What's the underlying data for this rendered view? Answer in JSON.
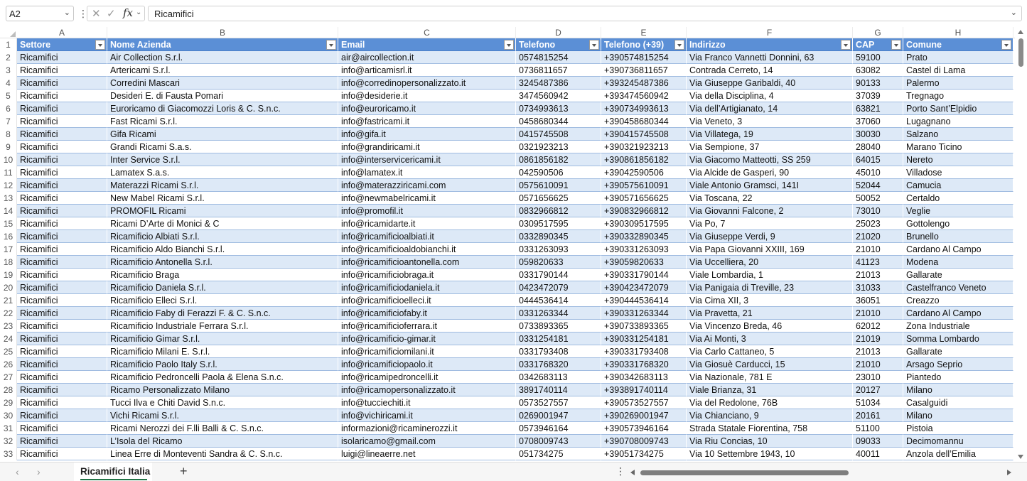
{
  "name_box": "A2",
  "formula_value": "Ricamifici",
  "columns": [
    "A",
    "B",
    "C",
    "D",
    "E",
    "F",
    "G",
    "H"
  ],
  "headers": [
    "Settore",
    "Nome Azienda",
    "Email",
    "Telefono",
    "Telefono (+39)",
    "Indirizzo",
    "CAP",
    "Comune"
  ],
  "rows": [
    [
      "Ricamifici",
      "Air Collection S.r.l.",
      "air@aircollection.it",
      "0574815254",
      "+390574815254",
      "Via Franco Vannetti Donnini, 63",
      "59100",
      "Prato"
    ],
    [
      "Ricamifici",
      "Artericami S.r.l.",
      "info@articamisrl.it",
      "0736811657",
      "+390736811657",
      "Contrada Cerreto, 14",
      "63082",
      "Castel di Lama"
    ],
    [
      "Ricamifici",
      "Corredini Mascari",
      "info@corredinopersonalizzato.it",
      "3245487386",
      "+393245487386",
      "Via Giuseppe Garibaldi, 40",
      "90133",
      "Palermo"
    ],
    [
      "Ricamifici",
      "Desideri E. di Fausta Pomari",
      "info@desiderie.it",
      "3474560942",
      "+393474560942",
      "Via della Disciplina, 4",
      "37039",
      "Tregnago"
    ],
    [
      "Ricamifici",
      "Euroricamo di Giacomozzi Loris & C. S.n.c.",
      "info@euroricamo.it",
      "0734993613",
      "+390734993613",
      "Via dell’Artigianato, 14",
      "63821",
      "Porto Sant’Elpidio"
    ],
    [
      "Ricamifici",
      "Fast Ricami S.r.l.",
      "info@fastricami.it",
      "0458680344",
      "+390458680344",
      "Via Veneto, 3",
      "37060",
      "Lugagnano"
    ],
    [
      "Ricamifici",
      "Gifa Ricami",
      "info@gifa.it",
      "0415745508",
      "+390415745508",
      "Via Villatega, 19",
      "30030",
      "Salzano"
    ],
    [
      "Ricamifici",
      "Grandi Ricami S.a.s.",
      "info@grandiricami.it",
      "0321923213",
      "+390321923213",
      "Via Sempione, 37",
      "28040",
      "Marano Ticino"
    ],
    [
      "Ricamifici",
      "Inter Service S.r.l.",
      "info@interservicericami.it",
      "0861856182",
      "+390861856182",
      "Via Giacomo Matteotti, SS 259",
      "64015",
      "Nereto"
    ],
    [
      "Ricamifici",
      "Lamatex S.a.s.",
      "info@lamatex.it",
      "042590506",
      "+39042590506",
      "Via Alcide de Gasperi, 90",
      "45010",
      "Villadose"
    ],
    [
      "Ricamifici",
      "Materazzi Ricami S.r.l.",
      "info@materazziricami.com",
      "0575610091",
      "+390575610091",
      "Viale Antonio Gramsci, 141I",
      "52044",
      "Camucia"
    ],
    [
      "Ricamifici",
      "New Mabel Ricami S.r.l.",
      "info@newmabelricami.it",
      "0571656625",
      "+390571656625",
      "Via Toscana, 22",
      "50052",
      "Certaldo"
    ],
    [
      "Ricamifici",
      "PROMOFIL Ricami",
      "info@promofil.it",
      "0832966812",
      "+390832966812",
      "Via Giovanni Falcone, 2",
      "73010",
      "Veglie"
    ],
    [
      "Ricamifici",
      "Ricami D’Arte di Monici & C",
      "info@ricamidarte.it",
      "0309517595",
      "+390309517595",
      "Via Po, 7",
      "25023",
      "Gottolengo"
    ],
    [
      "Ricamifici",
      "Ricamificio Albiati S.r.l.",
      "info@ricamificioalbiati.it",
      "0332890345",
      "+390332890345",
      "Via Giuseppe Verdi, 9",
      "21020",
      "Brunello"
    ],
    [
      "Ricamifici",
      "Ricamificio Aldo Bianchi S.r.l.",
      "info@ricamificioaldobianchi.it",
      "0331263093",
      "+390331263093",
      "Via Papa Giovanni XXIII, 169",
      "21010",
      "Cardano Al Campo"
    ],
    [
      "Ricamifici",
      "Ricamificio Antonella S.r.l.",
      "info@ricamificioantonella.com",
      "059820633",
      "+39059820633",
      "Via Uccelliera, 20",
      "41123",
      "Modena"
    ],
    [
      "Ricamifici",
      "Ricamificio Braga",
      "info@ricamificiobraga.it",
      "0331790144",
      "+390331790144",
      "Viale Lombardia, 1",
      "21013",
      "Gallarate"
    ],
    [
      "Ricamifici",
      "Ricamificio Daniela S.r.l.",
      "info@ricamificiodaniela.it",
      "0423472079",
      "+390423472079",
      "Via Panigaia di Treville, 23",
      "31033",
      "Castelfranco Veneto"
    ],
    [
      "Ricamifici",
      "Ricamificio Elleci S.r.l.",
      "info@ricamificioelleci.it",
      "0444536414",
      "+390444536414",
      "Via Cima XII, 3",
      "36051",
      "Creazzo"
    ],
    [
      "Ricamifici",
      "Ricamificio Faby di Ferazzi F. & C. S.n.c.",
      "info@ricamificiofaby.it",
      "0331263344",
      "+390331263344",
      "Via Pravetta, 21",
      "21010",
      "Cardano Al Campo"
    ],
    [
      "Ricamifici",
      "Ricamificio Industriale Ferrara S.r.l.",
      "info@ricamificioferrara.it",
      "0733893365",
      "+390733893365",
      "Via Vincenzo Breda, 46",
      "62012",
      "Zona Industriale"
    ],
    [
      "Ricamifici",
      "Ricamificio Gimar S.r.l.",
      "info@ricamificio-gimar.it",
      "0331254181",
      "+390331254181",
      "Via Ai Monti, 3",
      "21019",
      "Somma Lombardo"
    ],
    [
      "Ricamifici",
      "Ricamificio Milani E. S.r.l.",
      "info@ricamificiomilani.it",
      "0331793408",
      "+390331793408",
      "Via Carlo Cattaneo, 5",
      "21013",
      "Gallarate"
    ],
    [
      "Ricamifici",
      "Ricamificio Paolo Italy S.r.l.",
      "info@ricamificiopaolo.it",
      "0331768320",
      "+390331768320",
      "Via Giosuè Carducci, 15",
      "21010",
      "Arsago Seprio"
    ],
    [
      "Ricamifici",
      "Ricamificio Pedroncelli Paola & Elena S.n.c.",
      "info@ricamipedroncelli.it",
      "0342683113",
      "+390342683113",
      "Via Nazionale, 781 E",
      "23010",
      "Piantedo"
    ],
    [
      "Ricamifici",
      "Ricamo Personalizzato Milano",
      "info@ricamopersonalizzato.it",
      "3891740114",
      "+393891740114",
      "Viale Brianza, 31",
      "20127",
      "Milano"
    ],
    [
      "Ricamifici",
      "Tucci Ilva e Chiti David S.n.c.",
      "info@tucciechiti.it",
      "0573527557",
      "+390573527557",
      "Via del Redolone, 76B",
      "51034",
      "Casalguidi"
    ],
    [
      "Ricamifici",
      "Vichi Ricami S.r.l.",
      "info@vichiricami.it",
      "0269001947",
      "+390269001947",
      "Via Chianciano, 9",
      "20161",
      "Milano"
    ],
    [
      "Ricamifici",
      "Ricami Nerozzi dei F.lli Balli & C. S.n.c.",
      "informazioni@ricaminerozzi.it",
      "0573946164",
      "+390573946164",
      "Strada Statale Fiorentina, 758",
      "51100",
      "Pistoia"
    ],
    [
      "Ricamifici",
      "L’Isola del Ricamo",
      "isolaricamo@gmail.com",
      "0708009743",
      "+390708009743",
      "Via Riu Concias, 10",
      "09033",
      "Decimomannu"
    ],
    [
      "Ricamifici",
      "Linea Erre di Monteventi Sandra & C. S.n.c.",
      "luigi@lineaerre.net",
      "051734275",
      "+39051734275",
      "Via 10 Settembre 1943, 10",
      "40011",
      "Anzola dell’Emilia"
    ]
  ],
  "sheet_tab": "Ricamifici Italia",
  "colors": {
    "header_bg": "#5b8fd6",
    "band": "#dde9f7",
    "accent": "#217346"
  }
}
